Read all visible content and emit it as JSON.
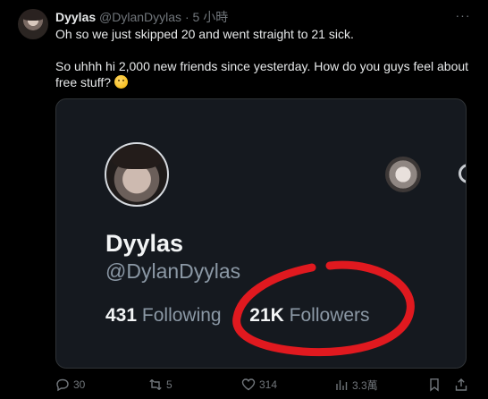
{
  "tweet": {
    "author_name": "Dyylas",
    "author_handle": "@DylanDyylas",
    "separator": "·",
    "time": "5 小時",
    "more_label": "···",
    "text_line1": "Oh so we just skipped 20 and went straight to 21 sick.",
    "text_line2": "So uhhh hi 2,000 new friends since yesterday. How do you guys feel about free stuff?",
    "emoji_name": "thinking-face"
  },
  "media": {
    "display_name": "Dyylas",
    "handle": "@DylanDyylas",
    "following_count": "431",
    "following_label": "Following",
    "followers_count": "21K",
    "followers_label": "Followers",
    "highlight_color": "#e0191f"
  },
  "actions": {
    "replies": "30",
    "reposts": "5",
    "likes": "314",
    "views": "3.3萬"
  },
  "colors": {
    "background": "#000000",
    "text": "#e7e9ea",
    "muted": "#71767b",
    "card": "#15191f"
  }
}
